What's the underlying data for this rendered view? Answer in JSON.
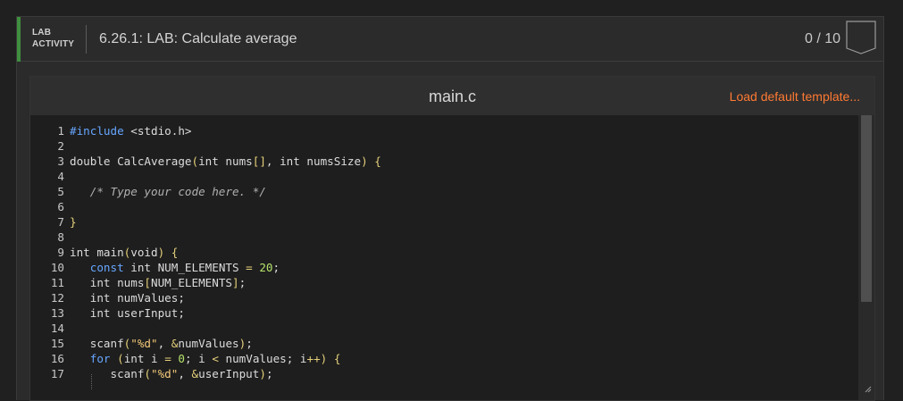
{
  "header": {
    "activity_label_line1": "LAB",
    "activity_label_line2": "ACTIVITY",
    "title": "6.26.1: LAB: Calculate average",
    "score": "0 / 10"
  },
  "editor": {
    "file_name": "main.c",
    "load_template_label": "Load default template...",
    "line_numbers": [
      "1",
      "2",
      "3",
      "4",
      "5",
      "6",
      "7",
      "8",
      "9",
      "10",
      "11",
      "12",
      "13",
      "14",
      "15",
      "16",
      "17"
    ]
  },
  "colors": {
    "accent": "#3f8f3f",
    "link": "#ff7a33",
    "background": "#202020"
  },
  "icons": {
    "badge": "bookmark-badge-icon",
    "resize": "resize-grip-icon"
  }
}
